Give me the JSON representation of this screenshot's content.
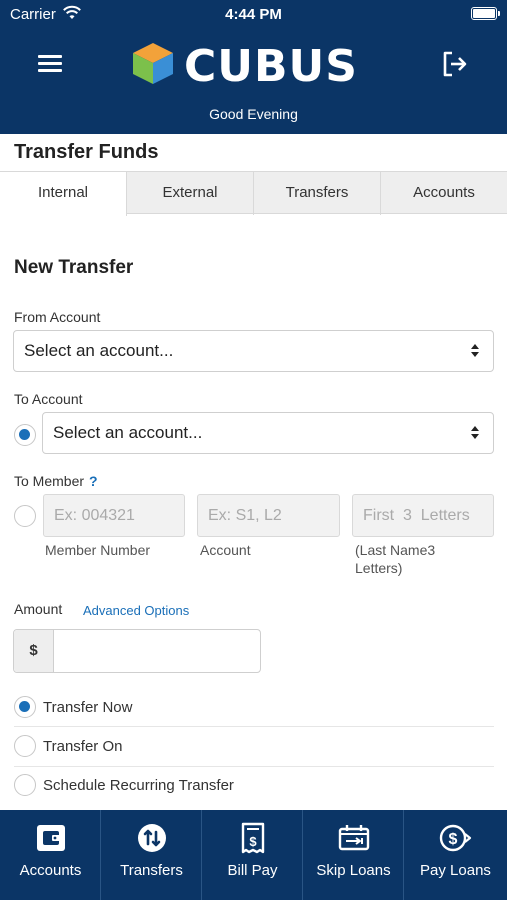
{
  "status_bar": {
    "carrier": "Carrier",
    "time": "4:44 PM"
  },
  "header": {
    "brand": "CUBUS",
    "greeting": "Good Evening"
  },
  "page": {
    "title": "Transfer Funds"
  },
  "tabs": [
    {
      "label": "Internal",
      "active": true
    },
    {
      "label": "External",
      "active": false
    },
    {
      "label": "Transfers",
      "active": false
    },
    {
      "label": "Accounts",
      "active": false
    }
  ],
  "form": {
    "section_title": "New Transfer",
    "from_account": {
      "label": "From Account",
      "value": "Select an account..."
    },
    "to_account": {
      "label": "To Account",
      "value": "Select an account...",
      "selected": true
    },
    "to_member": {
      "label": "To Member",
      "help": "?",
      "selected": false,
      "member_number": {
        "placeholder": "Ex: 004321",
        "hint": "Member Number"
      },
      "account": {
        "placeholder": "Ex: S1, L2",
        "hint": "Account"
      },
      "last_name": {
        "placeholder": "First  3  Letters",
        "hint_line1": "(Last Name3",
        "hint_line2": "Letters)"
      }
    },
    "amount": {
      "label": "Amount",
      "advanced_link": "Advanced Options",
      "currency_prefix": "$",
      "value": ""
    },
    "timing_options": [
      {
        "label": "Transfer Now",
        "selected": true
      },
      {
        "label": "Transfer On",
        "selected": false
      },
      {
        "label": "Schedule Recurring Transfer",
        "selected": false
      }
    ]
  },
  "bottom_nav": [
    {
      "label": "Accounts",
      "icon": "wallet-icon"
    },
    {
      "label": "Transfers",
      "icon": "transfer-arrows-icon"
    },
    {
      "label": "Bill Pay",
      "icon": "bill-icon"
    },
    {
      "label": "Skip Loans",
      "icon": "skip-loans-icon"
    },
    {
      "label": "Pay Loans",
      "icon": "pay-loans-icon"
    }
  ],
  "colors": {
    "brand_navy": "#0b3566",
    "accent_blue": "#1a6fb8",
    "logo_cube": [
      "#f2a23a",
      "#7cc04b",
      "#3a8fd6"
    ]
  }
}
